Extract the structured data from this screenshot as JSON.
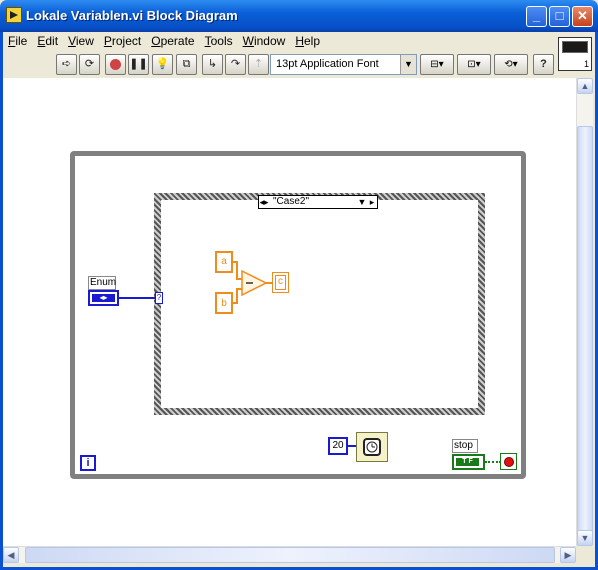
{
  "window": {
    "title": "Lokale Variablen.vi Block Diagram",
    "buttons": [
      "minimize",
      "maximize",
      "close"
    ]
  },
  "menu": [
    "File",
    "Edit",
    "View",
    "Project",
    "Operate",
    "Tools",
    "Window",
    "Help"
  ],
  "toolbar": {
    "font": "13pt Application Font",
    "help": "?"
  },
  "vi_icon": {
    "label": "1"
  },
  "diagram": {
    "case_selector": "\"Case2\"",
    "selector_terminal": "?",
    "enum_label": "Enum",
    "enum_symbol": "◂▸",
    "controls": {
      "a": "a",
      "b": "b"
    },
    "indicator_c": "c",
    "info_symbol": "i",
    "wait_constant": "20",
    "stop_label": "stop",
    "stop_tf": "T F"
  },
  "colors": {
    "title_bar": "#0a5fd8",
    "integer_wire": "#1a1ad0",
    "numeric_wire": "#f08c1e",
    "boolean_wire": "#1a7a1a",
    "loop_border": "#808080"
  }
}
